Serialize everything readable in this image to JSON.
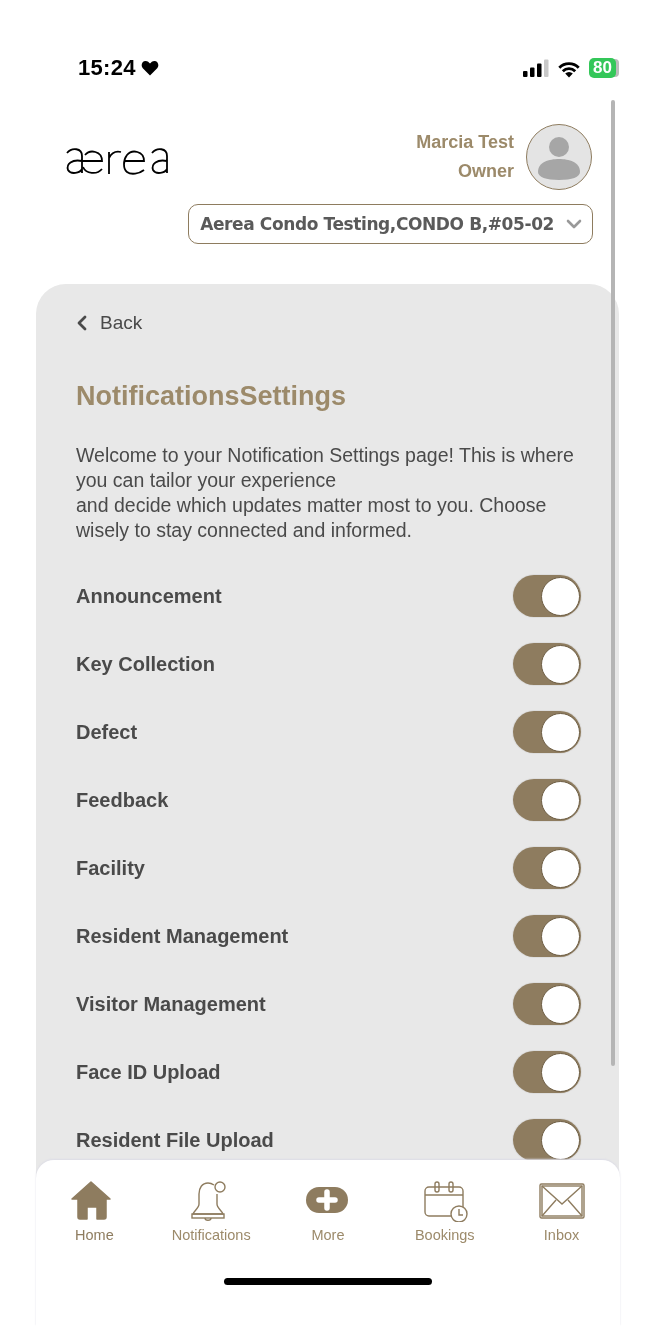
{
  "status_bar": {
    "time": "15:24",
    "battery": "80"
  },
  "header": {
    "user_name": "Marcia Test",
    "user_role": "Owner",
    "unit_selector": "Aerea Condo Testing,CONDO B,#05-02"
  },
  "page": {
    "back": "Back",
    "title": "NotificationsSettings",
    "intro": "Welcome to your Notification Settings page! This is where you can tailor your experience\nand decide which updates matter most to you. Choose wisely to stay connected and informed.",
    "settings": [
      {
        "label": "Announcement",
        "on": true
      },
      {
        "label": "Key Collection",
        "on": true
      },
      {
        "label": "Defect",
        "on": true
      },
      {
        "label": "Feedback",
        "on": true
      },
      {
        "label": "Facility",
        "on": true
      },
      {
        "label": "Resident Management",
        "on": true
      },
      {
        "label": "Visitor Management",
        "on": true
      },
      {
        "label": "Face ID Upload",
        "on": true
      },
      {
        "label": "Resident File Upload",
        "on": true
      }
    ]
  },
  "tab_bar": [
    {
      "kind": "home",
      "label": "Home",
      "selected": true
    },
    {
      "kind": "bell",
      "label": "Notifications",
      "selected": false
    },
    {
      "kind": "more",
      "label": "More",
      "selected": false
    },
    {
      "kind": "calendar",
      "label": "Bookings",
      "selected": false
    },
    {
      "kind": "mail",
      "label": "Inbox",
      "selected": false
    }
  ]
}
